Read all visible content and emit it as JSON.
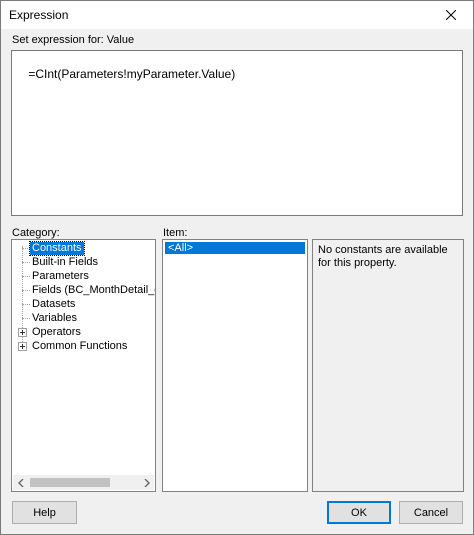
{
  "window": {
    "title": "Expression"
  },
  "expression": {
    "label": "Set expression for: Value",
    "value": "=CInt(Parameters!myParameter.Value)"
  },
  "category": {
    "label": "Category:",
    "items": [
      {
        "label": "Constants",
        "selected": true,
        "expandable": false
      },
      {
        "label": "Built-in Fields",
        "expandable": false
      },
      {
        "label": "Parameters",
        "expandable": false
      },
      {
        "label": "Fields (BC_MonthDetail_dat",
        "expandable": false
      },
      {
        "label": "Datasets",
        "expandable": false
      },
      {
        "label": "Variables",
        "expandable": false
      },
      {
        "label": "Operators",
        "expandable": true
      },
      {
        "label": "Common Functions",
        "expandable": true
      }
    ]
  },
  "item": {
    "label": "Item:",
    "items": [
      {
        "label": "<All>",
        "selected": true
      }
    ]
  },
  "description": {
    "text": "No constants are available for this property."
  },
  "buttons": {
    "help": "Help",
    "ok": "OK",
    "cancel": "Cancel"
  },
  "colors": {
    "selection": "#0078d7",
    "background": "#f0f0f0"
  }
}
